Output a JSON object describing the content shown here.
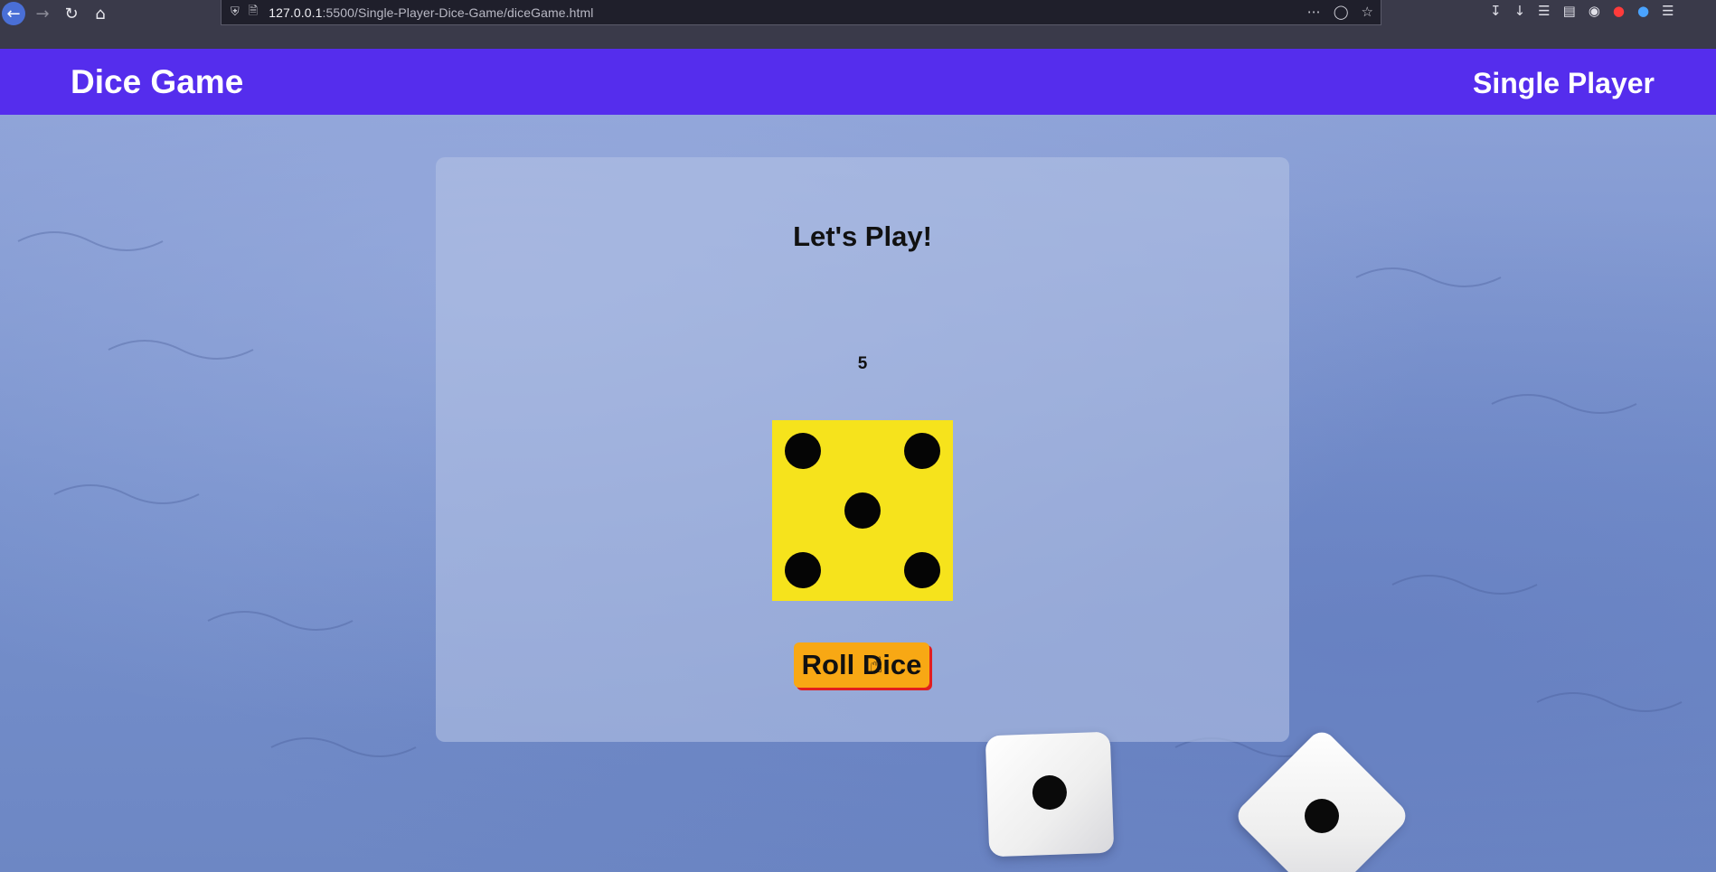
{
  "browser": {
    "url_host": "127.0.0.1",
    "url_rest": ":5500/Single-Player-Dice-Game/diceGame.html"
  },
  "header": {
    "title": "Dice Game",
    "mode": "Single Player"
  },
  "game": {
    "heading": "Let's Play!",
    "result": "5",
    "die_value": 5,
    "roll_button_label": "Roll Dice"
  },
  "colors": {
    "header_bg": "#552ded",
    "die_face": "#f6e31c",
    "button_bg": "#f8a814",
    "button_shadow": "#e21e1e"
  },
  "icons": [
    "back-arrow-icon",
    "forward-arrow-icon",
    "reload-icon",
    "home-icon",
    "shield-icon",
    "page-icon",
    "more-icon",
    "pocket-icon",
    "star-icon",
    "download-icon",
    "library-icon",
    "sidebar-icon",
    "account-icon",
    "hand-cursor-icon"
  ]
}
